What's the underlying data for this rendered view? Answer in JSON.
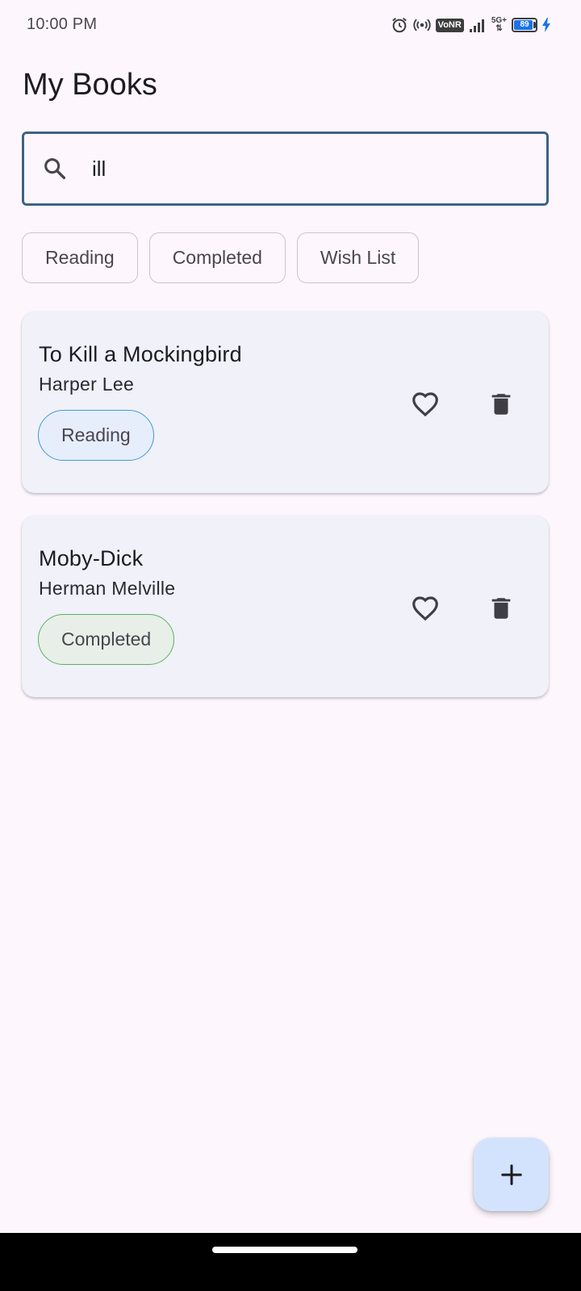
{
  "status_bar": {
    "time": "10:00 PM",
    "vonr": "VoNR",
    "network": "5G+",
    "battery": "89",
    "battery_level": 0.89
  },
  "header": {
    "title": "My Books"
  },
  "search": {
    "value": "ill",
    "placeholder": ""
  },
  "filters": {
    "items": [
      {
        "label": "Reading"
      },
      {
        "label": "Completed"
      },
      {
        "label": "Wish List"
      }
    ]
  },
  "books": [
    {
      "title": "To Kill a Mockingbird",
      "author": "Harper Lee",
      "status": "Reading",
      "status_color": "#3c9bd6"
    },
    {
      "title": "Moby-Dick",
      "author": "Herman Melville",
      "status": "Completed",
      "status_color": "#5cb25f"
    }
  ],
  "icons": {
    "search": "search-icon",
    "favorite": "heart-outline-icon",
    "delete": "trash-icon",
    "add": "plus-icon"
  },
  "colors": {
    "background": "#fdf7fd",
    "search_border": "#3f6284",
    "card_background": "#f0f1f9",
    "fab_background": "#d3e3fd"
  }
}
